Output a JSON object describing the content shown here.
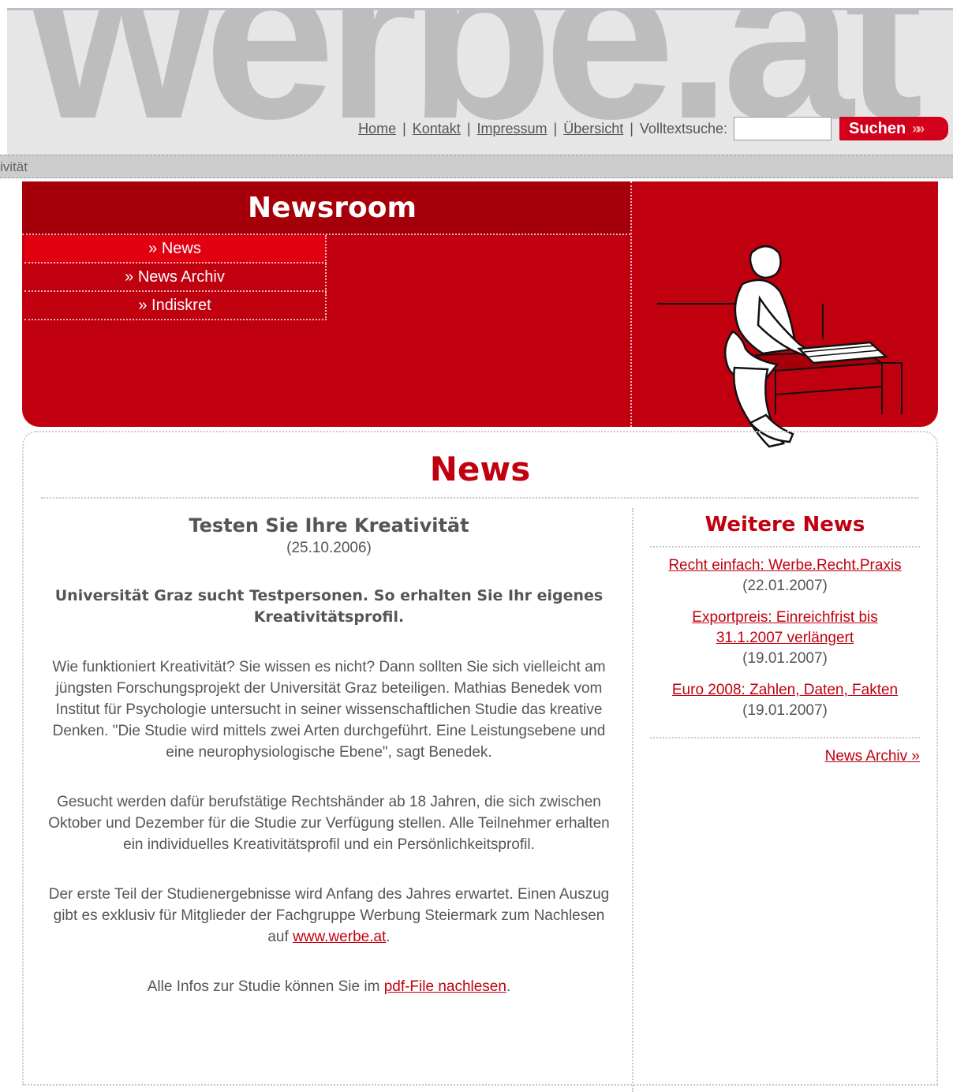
{
  "header": {
    "logo_text": "werbe.at",
    "nav": {
      "home": "Home",
      "kontakt": "Kontakt",
      "impressum": "Impressum",
      "uebersicht": "Übersicht",
      "separator": "|",
      "search_label": "Volltextsuche:",
      "search_value": "",
      "search_button": "Suchen",
      "search_button_arrows": "»»"
    },
    "breadcrumb": "ivität"
  },
  "newsroom": {
    "title": "Newsroom",
    "subnav": [
      {
        "label": "» News",
        "active": true
      },
      {
        "label": "» News Archiv",
        "active": false
      },
      {
        "label": "» Indiskret",
        "active": false
      }
    ]
  },
  "content": {
    "title": "News",
    "article": {
      "title": "Testen Sie Ihre Kreativität",
      "date": "(25.10.2006)",
      "lead": "Universität Graz sucht Testpersonen. So erhalten Sie Ihr eigenes Kreativitätsprofil.",
      "p1": "Wie funktioniert Kreativität? Sie wissen es nicht? Dann sollten Sie sich vielleicht am jüngsten Forschungsprojekt der Universität Graz beteiligen. Mathias Benedek vom Institut für Psychologie untersucht in seiner wissenschaftlichen Studie das kreative Denken. \"Die Studie wird mittels zwei Arten durchgeführt. Eine Leistungsebene und eine neurophysiologische Ebene\", sagt Benedek.",
      "p2": "Gesucht werden dafür berufstätige Rechtshänder ab 18 Jahren, die sich zwischen Oktober und Dezember für die Studie zur Verfügung stellen. Alle Teilnehmer erhalten ein individuelles Kreativitätsprofil und ein Persönlichkeitsprofil.",
      "p3_before": "Der erste Teil der Studienergebnisse wird Anfang des Jahres erwartet. Einen Auszug gibt es exklusiv für Mitglieder der Fachgruppe Werbung Steiermark zum Nachlesen auf ",
      "p3_link": "www.werbe.at",
      "p3_after": ".",
      "p4_before": "Alle Infos zur Studie können Sie im ",
      "p4_link": "pdf-File nachlesen",
      "p4_after": "."
    },
    "sidebar": {
      "title": "Weitere News",
      "items": [
        {
          "title": "Recht einfach: Werbe.Recht.Praxis",
          "date": "(22.01.2007)"
        },
        {
          "title": "Exportpreis: Einreichfrist bis 31.1.2007 verlängert",
          "date": "(19.01.2007)"
        },
        {
          "title": "Euro 2008: Zahlen, Daten, Fakten",
          "date": "(19.01.2007)"
        }
      ],
      "archive_link": "News Archiv »"
    }
  },
  "colors": {
    "brand_red": "#c0000f",
    "dark_red": "#a50009",
    "active_red": "#e00010",
    "header_grey": "#e6e6e6"
  }
}
